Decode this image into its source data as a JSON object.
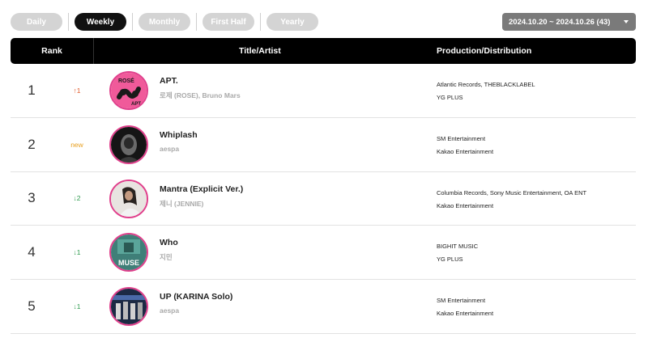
{
  "period_tabs": [
    {
      "label": "Daily",
      "active": false
    },
    {
      "label": "Weekly",
      "active": true
    },
    {
      "label": "Monthly",
      "active": false
    },
    {
      "label": "First Half",
      "active": false
    },
    {
      "label": "Yearly",
      "active": false
    }
  ],
  "date_range": {
    "label": "2024.10.20 ~ 2024.10.26 (43)",
    "icon": "caret-down-icon"
  },
  "table": {
    "headers": {
      "rank": "Rank",
      "title_artist": "Title/Artist",
      "production": "Production/Distribution"
    },
    "rows": [
      {
        "rank": "1",
        "change": "↑1",
        "change_type": "up",
        "title": "APT.",
        "artist": "로제 (ROSE), Bruno Mars",
        "production": "Atlantic Records, THEBLACKLABEL",
        "distribution": "YG PLUS",
        "art_text": [
          "ROSÉ",
          "APT"
        ]
      },
      {
        "rank": "2",
        "change": "new",
        "change_type": "new",
        "title": "Whiplash",
        "artist": "aespa",
        "production": "SM Entertainment",
        "distribution": "Kakao Entertainment",
        "art_text": []
      },
      {
        "rank": "3",
        "change": "↓2",
        "change_type": "down",
        "title": "Mantra (Explicit Ver.)",
        "artist": "제니 (JENNIE)",
        "production": "Columbia Records, Sony Music Entertainment, OA ENT",
        "distribution": "Kakao Entertainment",
        "art_text": []
      },
      {
        "rank": "4",
        "change": "↓1",
        "change_type": "down",
        "title": "Who",
        "artist": "지민",
        "production": "BIGHIT MUSIC",
        "distribution": "YG PLUS",
        "art_text": [
          "MUSE"
        ]
      },
      {
        "rank": "5",
        "change": "↓1",
        "change_type": "down",
        "title": "UP (KARINA Solo)",
        "artist": "aespa",
        "production": "SM Entertainment",
        "distribution": "Kakao Entertainment",
        "art_text": []
      }
    ]
  },
  "colors": {
    "header_bg": "#000000",
    "active_tab": "#111111",
    "inactive_tab": "#d4d4d4",
    "up": "#e05a2a",
    "down": "#2e9a4e",
    "new": "#e8a020",
    "art_ring": "#e0408c"
  }
}
